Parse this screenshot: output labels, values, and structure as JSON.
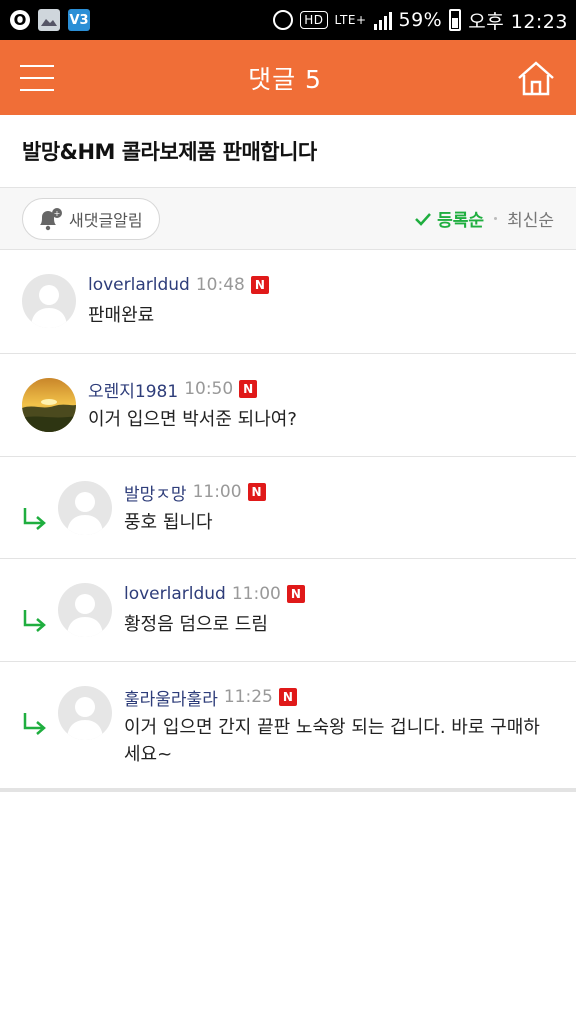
{
  "status_bar": {
    "battery": "59%",
    "time": "오후 12:23",
    "network": "LTE+",
    "hd": "HD"
  },
  "header": {
    "title": "댓글 5"
  },
  "post": {
    "title": "발망&HM 콜라보제품 판매합니다"
  },
  "toolbar": {
    "notify_label": "새댓글알림",
    "sort_active": "등록순",
    "sort_inactive": "최신순"
  },
  "badge_label": "N",
  "comments": [
    {
      "author": "loverlarldud",
      "time": "10:48",
      "text": "판매완료",
      "reply": false,
      "avatar": "default"
    },
    {
      "author": "오렌지1981",
      "time": "10:50",
      "text": "이거 입으면 박서준 되나여?",
      "reply": false,
      "avatar": "photo"
    },
    {
      "author": "발망ㅈ망",
      "time": "11:00",
      "text": "풍호 됩니다",
      "reply": true,
      "avatar": "default"
    },
    {
      "author": "loverlarldud",
      "time": "11:00",
      "text": "황정음 덤으로 드림",
      "reply": true,
      "avatar": "default"
    },
    {
      "author": "훌라울라훌라",
      "time": "11:25",
      "text": "이거 입으면 간지 끝판 노숙왕 되는 겁니다. 바로 구매하세요~",
      "reply": true,
      "avatar": "default"
    }
  ],
  "colors": {
    "header_bg": "#f06e37",
    "accent_green": "#1fae3f",
    "author": "#2e3d7a",
    "badge": "#e01919"
  }
}
